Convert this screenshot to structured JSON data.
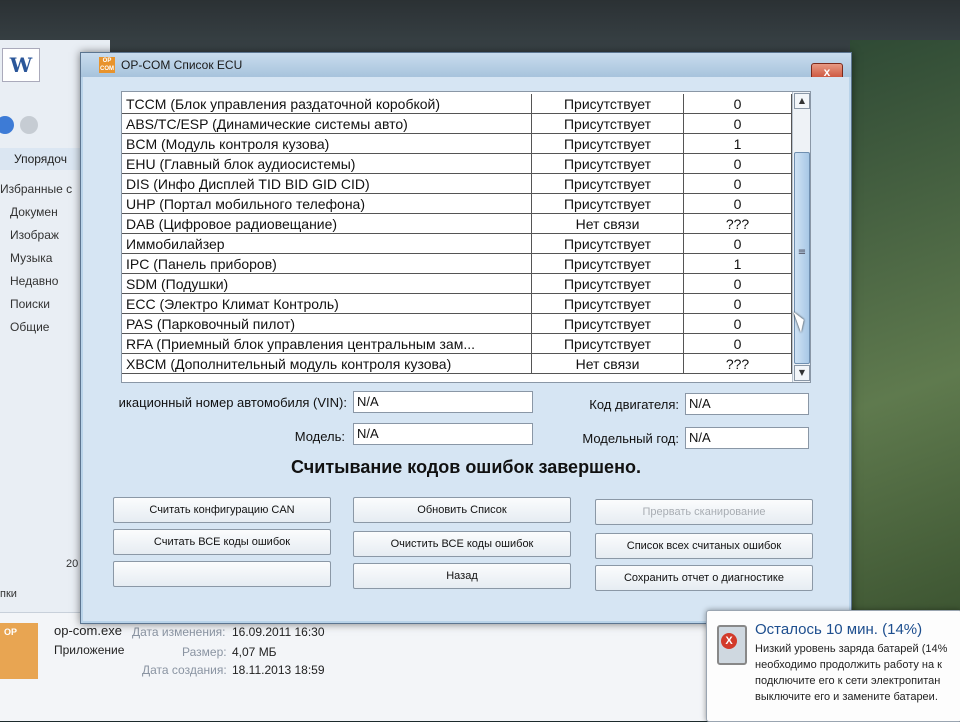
{
  "window": {
    "title": "OP-COM Список ECU",
    "app_icon": "OP COM",
    "close_label": "x"
  },
  "table": {
    "rows": [
      {
        "name": "TCCM (Блок управления раздаточной коробкой)",
        "status": "Присутствует",
        "code": "0"
      },
      {
        "name": "ABS/TC/ESP (Динамические системы авто)",
        "status": "Присутствует",
        "code": "0"
      },
      {
        "name": "BCM (Модуль контроля кузова)",
        "status": "Присутствует",
        "code": "1"
      },
      {
        "name": "EHU (Главный блок аудиосистемы)",
        "status": "Присутствует",
        "code": "0"
      },
      {
        "name": "DIS (Инфо Дисплей TID  BID  GID CID)",
        "status": "Присутствует",
        "code": "0"
      },
      {
        "name": "UHP (Портал мобильного телефона)",
        "status": "Присутствует",
        "code": "0"
      },
      {
        "name": "DAB (Цифровое радиовещание)",
        "status": "Нет связи",
        "code": "???"
      },
      {
        "name": "Иммобилайзер",
        "status": "Присутствует",
        "code": "0"
      },
      {
        "name": "IPC (Панель приборов)",
        "status": "Присутствует",
        "code": "1"
      },
      {
        "name": "SDM (Подушки)",
        "status": "Присутствует",
        "code": "0"
      },
      {
        "name": "ECC (Электро Климат Контроль)",
        "status": "Присутствует",
        "code": "0"
      },
      {
        "name": "PAS (Парковочный пилот)",
        "status": "Присутствует",
        "code": "0"
      },
      {
        "name": "RFA (Приемный блок управления центральным зам...",
        "status": "Присутствует",
        "code": "0"
      },
      {
        "name": "XBCM (Дополнительный модуль контроля кузова)",
        "status": "Нет связи",
        "code": "???"
      }
    ],
    "scroll_up": "▲",
    "scroll_down": "▼",
    "scroll_grip": "≡"
  },
  "fields": {
    "vin_label": "икационный номер автомобиля (VIN):",
    "vin_value": "N/A",
    "engine_label": "Код двигателя:",
    "engine_value": "N/A",
    "model_label": "Модель:",
    "model_value": "N/A",
    "year_label": "Модельный год:",
    "year_value": "N/A"
  },
  "status_message": "Считывание кодов ошибок завершено.",
  "buttons": {
    "read_can": "Считать конфигурацию CAN",
    "refresh": "Обновить Список",
    "abort_scan": "Прервать сканирование",
    "read_all": "Считать ВСЕ коды ошибок",
    "clear_all": "Очистить ВСЕ коды ошибок",
    "list_all": "Список всех считаных ошибок",
    "empty": "",
    "back": "Назад",
    "save_report": "Сохранить отчет о диагностике"
  },
  "explorer": {
    "toolbar": "Упорядоч",
    "nav": [
      "Избранные с",
      "Докумен",
      "Изображ",
      "Музыка",
      "Недавно",
      "Поиски",
      "Общие"
    ],
    "bottom_item": "пки",
    "bottom_num": "20",
    "file_name": "op-com.exe",
    "file_type": "Приложение",
    "modified_label": "Дата изменения:",
    "modified_value": "16.09.2011 16:30",
    "size_label": "Размер:",
    "size_value": "4,07 МБ",
    "created_label": "Дата создания:",
    "created_value": "18.11.2013 18:59",
    "word_icon": "W"
  },
  "battery": {
    "title": "Осталось 10 мин. (14%)",
    "lines": [
      "Низкий уровень заряда батарей (14%",
      "необходимо продолжить работу на к",
      "подключите его к сети электропитан",
      "выключите его и замените батареи."
    ],
    "x": "X"
  }
}
